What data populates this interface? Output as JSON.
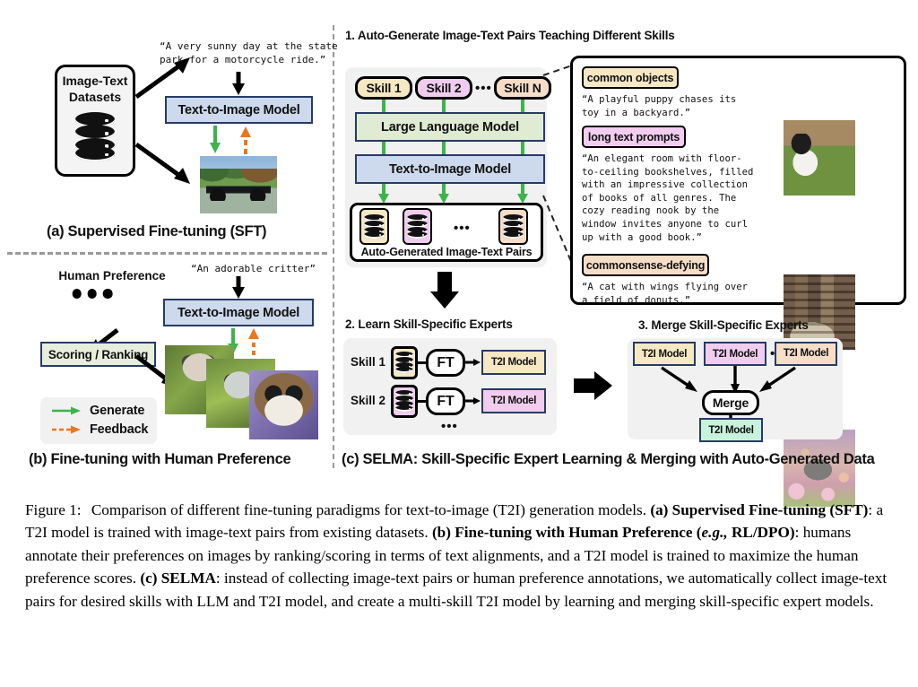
{
  "panels": {
    "a": {
      "caption": "(a) Supervised Fine-tuning (SFT)",
      "dataset_label_line1": "Image-Text",
      "dataset_label_line2": "Datasets",
      "prompt": "“A very sunny day at the state\npark for a motorcycle ride.”",
      "model_label": "Text-to-Image Model",
      "image_alt": "motorcycle-parked-at-state-park"
    },
    "b": {
      "caption": "(b) Fine-tuning with Human Preference",
      "human_preference_label": "Human Preference",
      "scoring_label": "Scoring / Ranking",
      "prompt": "“An adorable critter”",
      "model_label": "Text-to-Image Model",
      "images": [
        "critter-bush-baby",
        "critter-grey-kitten",
        "critter-big-eyed-lemur"
      ],
      "legend": [
        {
          "label": "Generate",
          "style": "solid",
          "color": "#3cb44b"
        },
        {
          "label": "Feedback",
          "style": "dashed",
          "color": "#e87722"
        }
      ]
    },
    "c": {
      "caption": "(c) SELMA: Skill-Specific Expert Learning & Merging with Auto-Generated Data",
      "step1": {
        "title": "1. Auto-Generate Image-Text Pairs Teaching Different Skills",
        "skills": [
          {
            "label": "Skill 1",
            "color": "#f6e8c3"
          },
          {
            "label": "Skill 2",
            "color": "#f0cdee"
          },
          {
            "label": "Skill N",
            "color": "#f6ddc8"
          }
        ],
        "ellipsis": "•••",
        "llm_label": "Large Language Model",
        "t2i_label": "Text-to-Image Model",
        "pairs_label": "Auto-Generated Image-Text Pairs"
      },
      "callout": {
        "items": [
          {
            "tag": "common objects",
            "tag_color": "#f6e8c3",
            "text": "“A playful puppy chases its\ntoy in a backyard.”",
            "image_alt": "puppy-playing-in-backyard"
          },
          {
            "tag": "long text prompts",
            "tag_color": "#f2cdf0",
            "text": "“An elegant room with floor-\nto-ceiling bookshelves, filled\nwith an impressive collection\nof books of all genres. The\ncozy reading nook by the\nwindow invites anyone to curl\nup with a good book.”",
            "image_alt": "elegant-library-reading-room"
          },
          {
            "tag": "commonsense-defying",
            "tag_color": "#f6ddc8",
            "text": "“A cat with wings flying over\na field of donuts.”",
            "image_alt": "winged-cat-flying-over-donuts"
          }
        ]
      },
      "step2": {
        "title": "2. Learn Skill-Specific Experts",
        "rows": [
          {
            "skill": "Skill 1",
            "ft": "FT",
            "model": "T2I Model",
            "color": "#f6e8c3"
          },
          {
            "skill": "Skill 2",
            "ft": "FT",
            "model": "T2I Model",
            "color": "#f0cdee"
          }
        ],
        "ellipsis": "•••"
      },
      "step3": {
        "title": "3. Merge Skill-Specific Experts",
        "experts": [
          {
            "label": "T2I Model",
            "color": "#f6e8c3"
          },
          {
            "label": "T2I Model",
            "color": "#f0cdee"
          },
          {
            "label": "T2I Model",
            "color": "#f6ddc8"
          }
        ],
        "ellipsis": "•••",
        "merge_label": "Merge",
        "result_label": "T2I Model",
        "result_color": "#c8f2dc"
      }
    }
  },
  "caption": {
    "figure_number": "Figure 1:",
    "line1": "Comparison of different fine-tuning paradigms for text-to-image (T2I) generation models.",
    "a_bold": "(a) Supervised Fine-tuning (SFT)",
    "a_rest": ": a T2I model is trained with image-text pairs from existing datasets.",
    "b_bold_1": "(b) Fine-tuning with Human Preference (",
    "b_bold_em": "e.g.,",
    "b_bold_2": " RL/DPO)",
    "b_rest": ": humans annotate their preferences on images by ranking/scoring in terms of text alignments, and a T2I model is trained to maximize the human preference scores. ",
    "c_bold_1": "(c) ",
    "c_bold_2": "SELMA",
    "c_rest": ": instead of collecting image-text pairs or human preference annotations, we automatically collect image-text pairs for desired skills with LLM and T2I model, and create a multi-skill T2I model by learning and merging skill-specific expert models."
  },
  "colors": {
    "generate_arrow": "#3cb44b",
    "feedback_arrow": "#e87722",
    "box_border": "#273b66",
    "t2i_fill": "#cdd9ec",
    "llm_fill": "#dfebd3",
    "panel_bg": "#f1f1f1"
  }
}
